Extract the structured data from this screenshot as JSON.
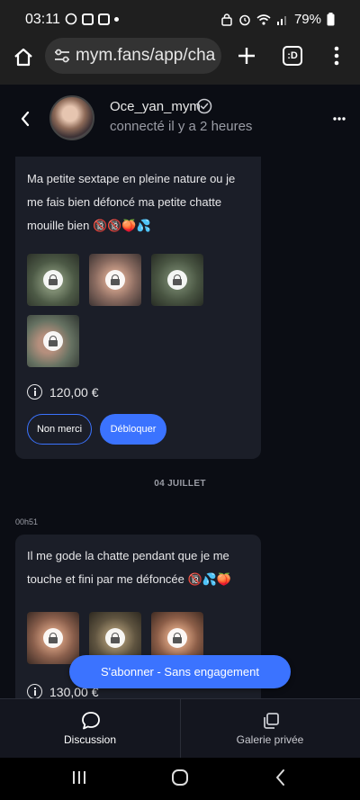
{
  "status_bar": {
    "time": "03:11",
    "battery": "79%"
  },
  "browser": {
    "url": "mym.fans/app/cha",
    "tab_count": ":D"
  },
  "profile": {
    "name": "Oce_yan_mym",
    "status": "connecté il y a 2 heures"
  },
  "messages": [
    {
      "text": "Ma petite sextape en pleine nature ou je me fais bien défoncé ma petite chatte mouille bien 🔞🔞🍑💦",
      "price": "120,00 €",
      "decline_label": "Non merci",
      "unlock_label": "Débloquer"
    },
    {
      "time": "00h51",
      "text": "Il me gode la chatte pendant que je me touche et fini par me défoncée 🔞💦🍑",
      "price": "130,00 €"
    }
  ],
  "date_separator": "04 JUILLET",
  "subscribe_label": "S'abonner - Sans engagement",
  "bottom_nav": {
    "discussion": "Discussion",
    "gallery": "Galerie privée"
  },
  "colors": {
    "accent": "#3b73ff",
    "bubble": "#1b1e28",
    "background": "#0b0d14"
  }
}
